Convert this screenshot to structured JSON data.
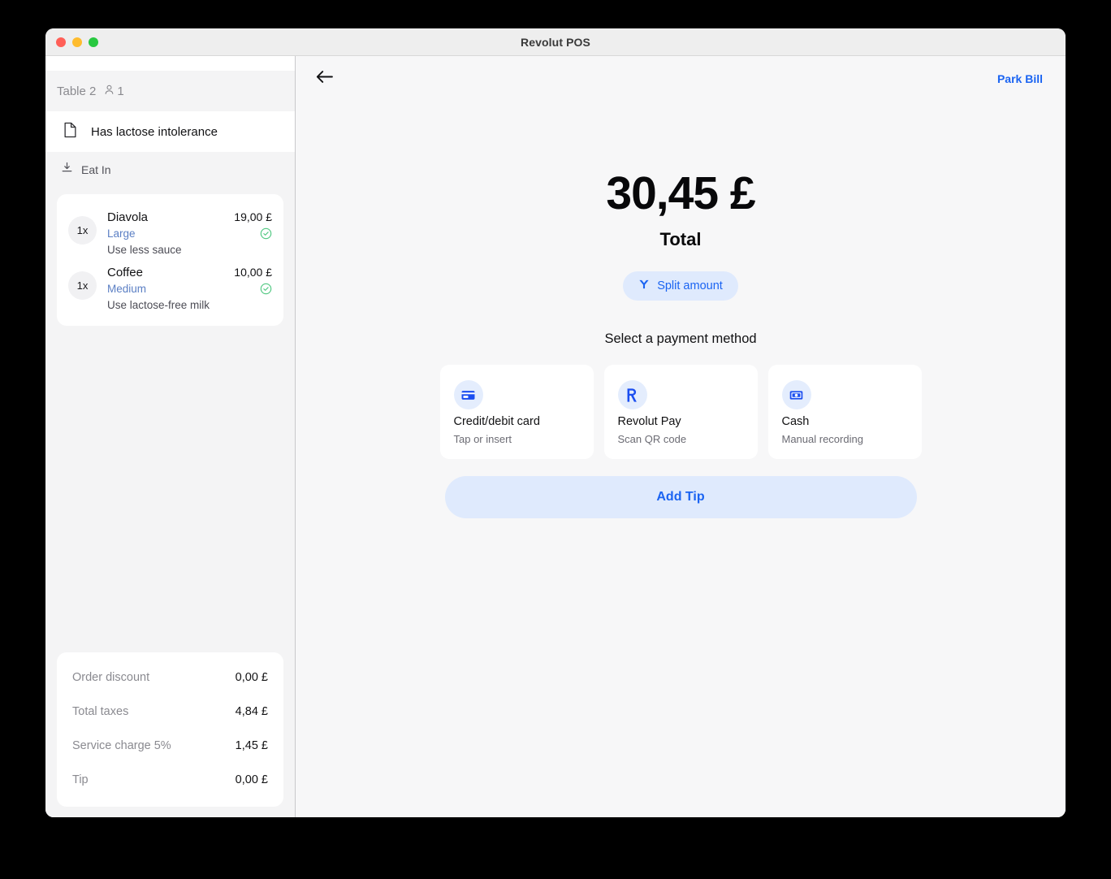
{
  "window": {
    "title": "Revolut POS",
    "traffic_lights": [
      "close",
      "minimize",
      "maximize"
    ]
  },
  "sidebar": {
    "table": {
      "name": "Table 2",
      "guest_count": "1"
    },
    "note": {
      "icon": "note-icon",
      "text": "Has lactose intolerance"
    },
    "service_type": {
      "icon": "eat-in-icon",
      "label": "Eat In"
    },
    "items": [
      {
        "qty": "1x",
        "name": "Diavola",
        "price": "19,00 £",
        "variant": "Large",
        "note": "Use less sauce",
        "status_icon": "check-circle-icon"
      },
      {
        "qty": "1x",
        "name": "Coffee",
        "price": "10,00 £",
        "variant": "Medium",
        "note": "Use lactose-free milk",
        "status_icon": "check-circle-icon"
      }
    ],
    "totals": [
      {
        "label": "Order discount",
        "value": "0,00 £"
      },
      {
        "label": "Total taxes",
        "value": "4,84 £"
      },
      {
        "label": "Service charge 5%",
        "value": "1,45 £"
      },
      {
        "label": "Tip",
        "value": "0,00 £"
      }
    ]
  },
  "main": {
    "back_icon": "back-arrow-icon",
    "park_bill": "Park Bill",
    "total_amount": "30,45 £",
    "total_label": "Total",
    "split_button": {
      "label": "Split amount",
      "icon": "split-icon"
    },
    "section_heading": "Select a payment method",
    "payment_methods": [
      {
        "title": "Credit/debit card",
        "subtitle": "Tap or insert",
        "icon": "credit-card-icon"
      },
      {
        "title": "Revolut Pay",
        "subtitle": "Scan QR code",
        "icon": "revolut-r-icon"
      },
      {
        "title": "Cash",
        "subtitle": "Manual recording",
        "icon": "cash-icon"
      }
    ],
    "add_tip": "Add Tip"
  },
  "colors": {
    "accent_blue": "#1b64f2",
    "accent_blue_soft": "#dfeafd",
    "variant_blue": "#5b7fc4",
    "status_green": "#3cbf67",
    "text_primary": "#111113",
    "text_muted": "#8a8a90"
  }
}
